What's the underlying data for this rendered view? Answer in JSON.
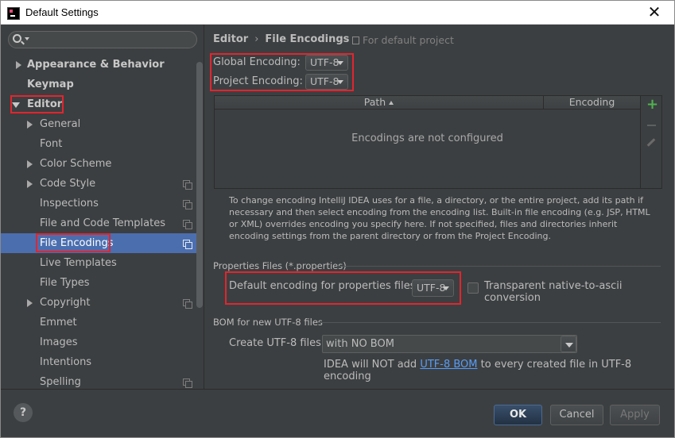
{
  "window": {
    "title": "Default Settings",
    "close_glyph": "✕"
  },
  "search": {
    "icon": "search-icon"
  },
  "sidebar": {
    "items": [
      {
        "label": "Appearance & Behavior",
        "level": 0,
        "expandable": true,
        "expanded": false,
        "bold": true
      },
      {
        "label": "Keymap",
        "level": 0,
        "expandable": false,
        "bold": true
      },
      {
        "label": "Editor",
        "level": 0,
        "expandable": true,
        "expanded": true,
        "bold": true
      },
      {
        "label": "General",
        "level": 1,
        "expandable": true
      },
      {
        "label": "Font",
        "level": 1
      },
      {
        "label": "Color Scheme",
        "level": 1,
        "expandable": true
      },
      {
        "label": "Code Style",
        "level": 1,
        "expandable": true,
        "project_icon": true
      },
      {
        "label": "Inspections",
        "level": 1,
        "project_icon": true
      },
      {
        "label": "File and Code Templates",
        "level": 1,
        "project_icon": true
      },
      {
        "label": "File Encodings",
        "level": 1,
        "project_icon": true,
        "selected": true
      },
      {
        "label": "Live Templates",
        "level": 1
      },
      {
        "label": "File Types",
        "level": 1
      },
      {
        "label": "Copyright",
        "level": 1,
        "expandable": true,
        "project_icon": true
      },
      {
        "label": "Emmet",
        "level": 1
      },
      {
        "label": "Images",
        "level": 1
      },
      {
        "label": "Intentions",
        "level": 1
      },
      {
        "label": "Spelling",
        "level": 1,
        "project_icon": true
      }
    ]
  },
  "breadcrumb": {
    "parent": "Editor",
    "separator": "›",
    "current": "File Encodings"
  },
  "scope": {
    "text": "For default project"
  },
  "global_encoding": {
    "label": "Global Encoding:",
    "value": "UTF-8"
  },
  "project_encoding": {
    "label": "Project Encoding:",
    "value": "UTF-8"
  },
  "table": {
    "columns": [
      "Path",
      "Encoding"
    ],
    "empty_text": "Encodings are not configured",
    "add_glyph": "+"
  },
  "help_text": "To change encoding IntelliJ IDEA uses for a file, a directory, or the entire project, add its path if necessary and then select encoding from the encoding list. Built-in file encoding (e.g. JSP, HTML or XML) overrides encoding you specify here. If not specified, files and directories inherit encoding settings from the parent directory or from the Project Encoding.",
  "properties": {
    "section_title": "Properties Files (*.properties)",
    "label": "Default encoding for properties files:",
    "value": "UTF-8",
    "transparent_label": "Transparent native-to-ascii conversion",
    "transparent_checked": false
  },
  "bom": {
    "section_title": "BOM for new UTF-8 files",
    "label": "Create UTF-8 files:",
    "value": "with NO BOM",
    "note_prefix": "IDEA will NOT add ",
    "note_link": "UTF-8 BOM",
    "note_suffix": " to every created file in UTF-8 encoding"
  },
  "footer": {
    "help": "?",
    "ok": "OK",
    "cancel": "Cancel",
    "apply": "Apply"
  },
  "colors": {
    "background": "#3c3f41",
    "selection": "#4b6eaf",
    "highlight_box": "#e2252f",
    "link": "#589df6",
    "add_green": "#4fb34f"
  }
}
